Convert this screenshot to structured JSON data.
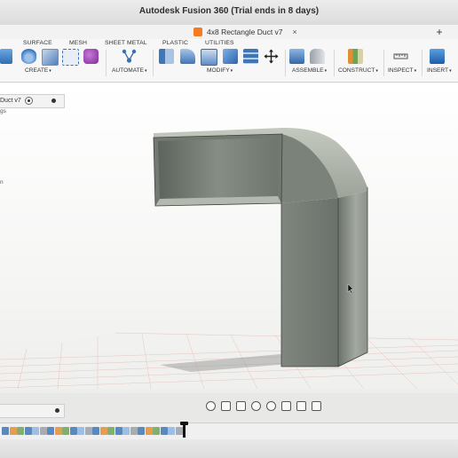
{
  "window": {
    "title": "Autodesk Fusion 360 (Trial ends in 8 days)"
  },
  "document_tab": {
    "title": "4x8 Rectangle Duct v7",
    "close_icon": "×",
    "add_icon": "+"
  },
  "ribbon": {
    "tabs": [
      "SURFACE",
      "MESH",
      "SHEET METAL",
      "PLASTIC",
      "UTILITIES"
    ],
    "groups": {
      "create": "CREATE",
      "automate": "AUTOMATE",
      "modify": "MODIFY",
      "assemble": "ASSEMBLE",
      "construct": "CONSTRUCT",
      "inspect": "INSPECT",
      "insert": "INSERT"
    },
    "caret": "▾"
  },
  "browser": {
    "item_label": "Duct v7",
    "sub_label_1": "gs",
    "sub_label_2": "n"
  },
  "colors": {
    "accent": "#f47b20",
    "duct_face_light": "#9aa097",
    "duct_face_dark": "#5f665f",
    "duct_interior": "#7d847b"
  },
  "icons": {
    "navbar": [
      "orbit-icon",
      "pan-icon",
      "hand-icon",
      "zoom-icon",
      "zoom-window-icon",
      "display-settings-icon",
      "grid-settings-icon",
      "viewport-layout-icon"
    ],
    "timeline_count": 24
  }
}
